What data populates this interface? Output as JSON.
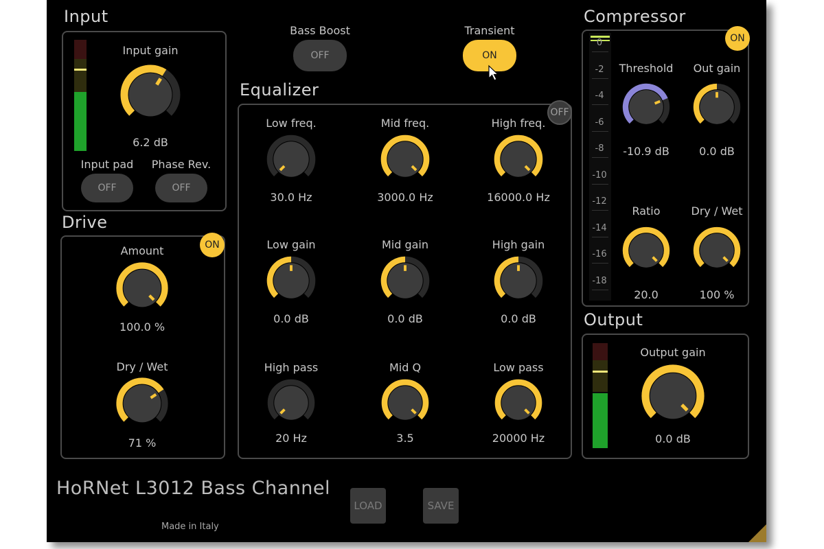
{
  "colors": {
    "accent": "#f8c537",
    "threshold_arc": "#8b85d8",
    "meter_green": "#1fa22b",
    "background": "#000000"
  },
  "input": {
    "title": "Input",
    "gain_label": "Input gain",
    "gain_value": "6.2 dB",
    "gain_fraction": 0.62,
    "meter_level": 0.5,
    "pad_label": "Input pad",
    "pad_state": "OFF",
    "phase_label": "Phase Rev.",
    "phase_state": "OFF"
  },
  "bass_boost": {
    "label": "Bass Boost",
    "state": "OFF"
  },
  "transient": {
    "label": "Transient",
    "state": "ON"
  },
  "drive": {
    "title": "Drive",
    "power": "ON",
    "amount_label": "Amount",
    "amount_value": "100.0 %",
    "amount_fraction": 1.0,
    "drywet_label": "Dry / Wet",
    "drywet_value": "71 %",
    "drywet_fraction": 0.71
  },
  "equalizer": {
    "title": "Equalizer",
    "power": "OFF",
    "knobs": [
      {
        "label": "Low freq.",
        "value": "30.0 Hz",
        "fraction": 0.0
      },
      {
        "label": "Mid freq.",
        "value": "3000.0 Hz",
        "fraction": 1.0
      },
      {
        "label": "High freq.",
        "value": "16000.0 Hz",
        "fraction": 1.0
      },
      {
        "label": "Low gain",
        "value": "0.0 dB",
        "fraction": 0.5
      },
      {
        "label": "Mid gain",
        "value": "0.0 dB",
        "fraction": 0.5
      },
      {
        "label": "High gain",
        "value": "0.0 dB",
        "fraction": 0.5
      },
      {
        "label": "High pass",
        "value": "20 Hz",
        "fraction": 0.0
      },
      {
        "label": "Mid Q",
        "value": "3.5",
        "fraction": 1.0
      },
      {
        "label": "Low pass",
        "value": "20000 Hz",
        "fraction": 1.0
      }
    ]
  },
  "compressor": {
    "title": "Compressor",
    "power": "ON",
    "meter_ticks": [
      "0",
      "-2",
      "-4",
      "-6",
      "-8",
      "-10",
      "-12",
      "-14",
      "-16",
      "-18"
    ],
    "threshold_label": "Threshold",
    "threshold_value": "-10.9 dB",
    "threshold_fraction": 0.75,
    "outgain_label": "Out gain",
    "outgain_value": "0.0 dB",
    "outgain_fraction": 0.5,
    "ratio_label": "Ratio",
    "ratio_value": "20.0",
    "ratio_fraction": 1.0,
    "drywet_label": "Dry / Wet",
    "drywet_value": "100 %",
    "drywet_fraction": 1.0
  },
  "output": {
    "title": "Output",
    "gain_label": "Output gain",
    "gain_value": "0.0 dB",
    "gain_fraction": 1.0,
    "meter_level": 0.5
  },
  "footer": {
    "product_name": "HoRNet L3012 Bass Channel",
    "made_in": "Made in Italy",
    "load_label": "LOAD",
    "save_label": "SAVE"
  }
}
